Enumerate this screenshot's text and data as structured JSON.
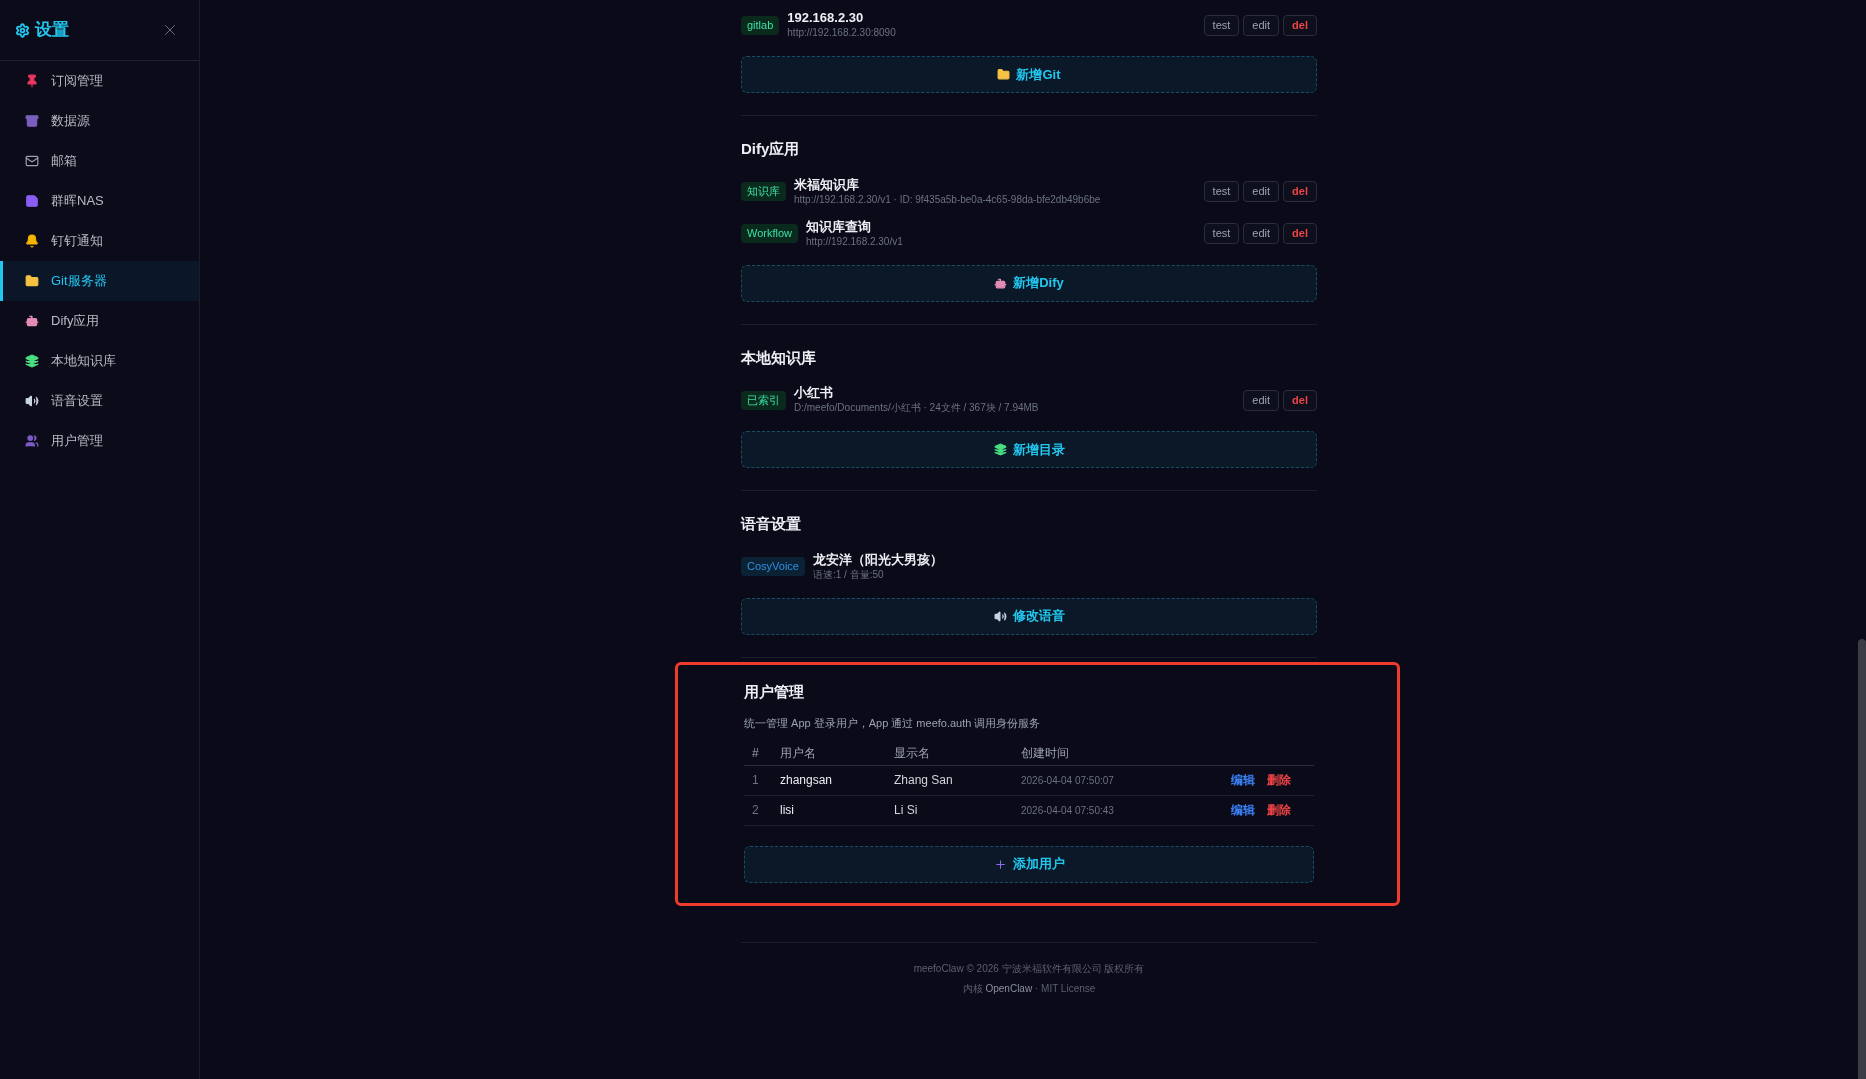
{
  "sidebar": {
    "title": "设置",
    "items": [
      {
        "label": "订阅管理",
        "selected": false
      },
      {
        "label": "数据源",
        "selected": false
      },
      {
        "label": "邮箱",
        "selected": false
      },
      {
        "label": "群晖NAS",
        "selected": false
      },
      {
        "label": "钉钉通知",
        "selected": false
      },
      {
        "label": "Git服务器",
        "selected": true
      },
      {
        "label": "Dify应用",
        "selected": false
      },
      {
        "label": "本地知识库",
        "selected": false
      },
      {
        "label": "语音设置",
        "selected": false
      },
      {
        "label": "用户管理",
        "selected": false
      }
    ]
  },
  "sections": [
    {
      "items": [
        {
          "tag": "gitlab",
          "color": "#0b2a1e",
          "title": "192.168.2.30",
          "subtitle": "http://192.168.2.30:8090",
          "actions": [
            {
              "label": "test",
              "danger": false
            },
            {
              "label": "edit",
              "danger": false
            },
            {
              "label": "del",
              "danger": true
            }
          ]
        }
      ],
      "add_button": "新增Git"
    },
    {
      "title": "Dify应用",
      "items": [
        {
          "tag": "知识库",
          "color": "#0b2a1e",
          "title": "米福知识库",
          "subtitle": "http://192.168.2.30/v1 · ID: 9f435a5b-be0a-4c65-98da-bfe2db49b6be",
          "actions": [
            {
              "label": "test",
              "danger": false
            },
            {
              "label": "edit",
              "danger": false
            },
            {
              "label": "del",
              "danger": true
            }
          ]
        },
        {
          "tag": "Workflow",
          "color": "#0b2a1e",
          "title": "知识库查询",
          "subtitle": "http://192.168.2.30/v1",
          "actions": [
            {
              "label": "test",
              "danger": false
            },
            {
              "label": "edit",
              "danger": false
            },
            {
              "label": "del",
              "danger": true
            }
          ]
        }
      ],
      "add_button": "新增Dify"
    },
    {
      "title": "本地知识库",
      "items": [
        {
          "tag": "已索引",
          "color": "#0b2a1e",
          "title": "小红书",
          "subtitle": "D:/meefo/Documents/小红书 · 24文件 / 367块 / 7.94MB",
          "actions": [
            {
              "label": "edit",
              "danger": false
            },
            {
              "label": "del",
              "danger": true
            }
          ]
        }
      ],
      "add_button": "新增目录"
    },
    {
      "title": "语音设置",
      "items": [
        {
          "tag": "CosyVoice",
          "color": "#0b2235",
          "title": "龙安洋（阳光大男孩）",
          "subtitle": "语速:1 / 音量:50"
        }
      ],
      "add_button": "修改语音"
    }
  ],
  "users": {
    "highlighted": true,
    "title": "用户管理",
    "description": "统一管理 App 登录用户，App 通过 meefo.auth 调用身份服务",
    "columns": [
      "#",
      "用户名",
      "显示名",
      "创建时间"
    ],
    "rows": [
      {
        "cells": [
          "1",
          "zhangsan",
          "Zhang San",
          "2026-04-04 07:50:07"
        ],
        "actions": [
          {
            "label": "编辑",
            "danger": false
          },
          {
            "label": "删除",
            "danger": true
          }
        ]
      },
      {
        "cells": [
          "2",
          "lisi",
          "Li Si",
          "2026-04-04 07:50:43"
        ],
        "actions": [
          {
            "label": "编辑",
            "danger": false
          },
          {
            "label": "删除",
            "danger": true
          }
        ]
      }
    ],
    "add_button": "添加用户"
  },
  "footer": {
    "line1": "meefoClaw © 2026 宁波米福软件有限公司 版权所有",
    "prefix": "内核",
    "link": "OpenClaw",
    "suffix": "· MIT License"
  }
}
